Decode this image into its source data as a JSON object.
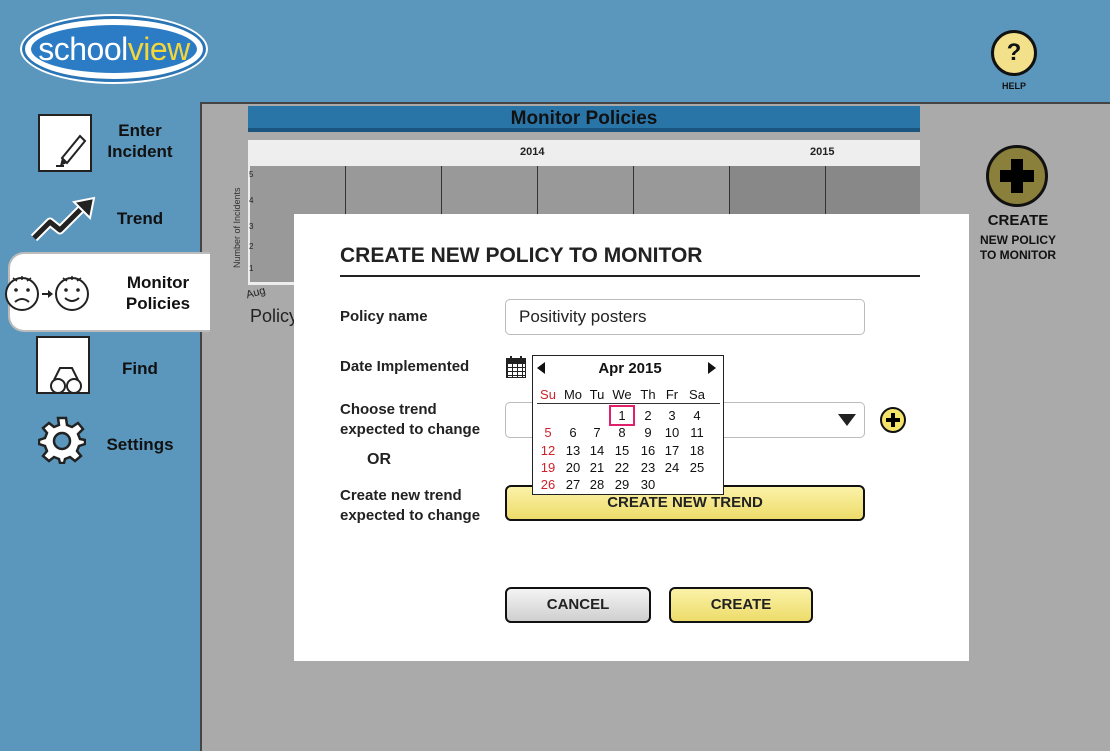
{
  "app": {
    "logo_text": "school",
    "logo_accent": "view",
    "help_label": "HELP",
    "help_glyph": "?"
  },
  "sidebar": {
    "items": [
      {
        "label_line1": "Enter",
        "label_line2": "Incident",
        "icon": "pencil-note-icon"
      },
      {
        "label_line1": "Trend",
        "label_line2": "",
        "icon": "trend-arrow-icon"
      },
      {
        "label_line1": "Monitor",
        "label_line2": "Policies",
        "icon": "sad-to-happy-face-icon",
        "active": true
      },
      {
        "label_line1": "Find",
        "label_line2": "",
        "icon": "binoculars-icon"
      },
      {
        "label_line1": "Settings",
        "label_line2": "",
        "icon": "gear-icon"
      }
    ]
  },
  "main": {
    "title": "Monitor Policies",
    "chart": {
      "years": [
        "2014",
        "2015"
      ],
      "y_axis_title": "Number of Incidents",
      "y_ticks": [
        "5",
        "4",
        "3",
        "2",
        "1"
      ],
      "first_x_label": "Aug",
      "policies_label": "Policy"
    },
    "create_button": {
      "line1": "CREATE",
      "line2": "NEW POLICY",
      "line3": "TO MONITOR"
    }
  },
  "modal": {
    "title": "CREATE NEW POLICY TO MONITOR",
    "policy_name_label": "Policy name",
    "policy_name_value": "Positivity posters",
    "date_label": "Date Implemented",
    "choose_trend_label_1": "Choose trend",
    "choose_trend_label_2": "expected to change",
    "or_label": "OR",
    "create_trend_label_1": "Create new trend",
    "create_trend_label_2": "expected to change",
    "create_trend_button": "CREATE NEW TREND",
    "cancel_button": "CANCEL",
    "create_button": "CREATE"
  },
  "datepicker": {
    "title": "Apr 2015",
    "weekdays": [
      "Su",
      "Mo",
      "Tu",
      "We",
      "Th",
      "Fr",
      "Sa"
    ],
    "weeks": [
      [
        "",
        "",
        "",
        "1",
        "2",
        "3",
        "4"
      ],
      [
        "5",
        "6",
        "7",
        "8",
        "9",
        "10",
        "11"
      ],
      [
        "12",
        "13",
        "14",
        "15",
        "16",
        "17",
        "18"
      ],
      [
        "19",
        "20",
        "21",
        "22",
        "23",
        "24",
        "25"
      ],
      [
        "26",
        "27",
        "28",
        "29",
        "30",
        "",
        ""
      ]
    ],
    "selected_day": "1"
  },
  "colors": {
    "background": "#5b97bd",
    "title_bar": "#2a75a8",
    "yellow_button": "#eddc6a",
    "sunday_red": "#d0202a",
    "selected_outline": "#e0206a"
  }
}
